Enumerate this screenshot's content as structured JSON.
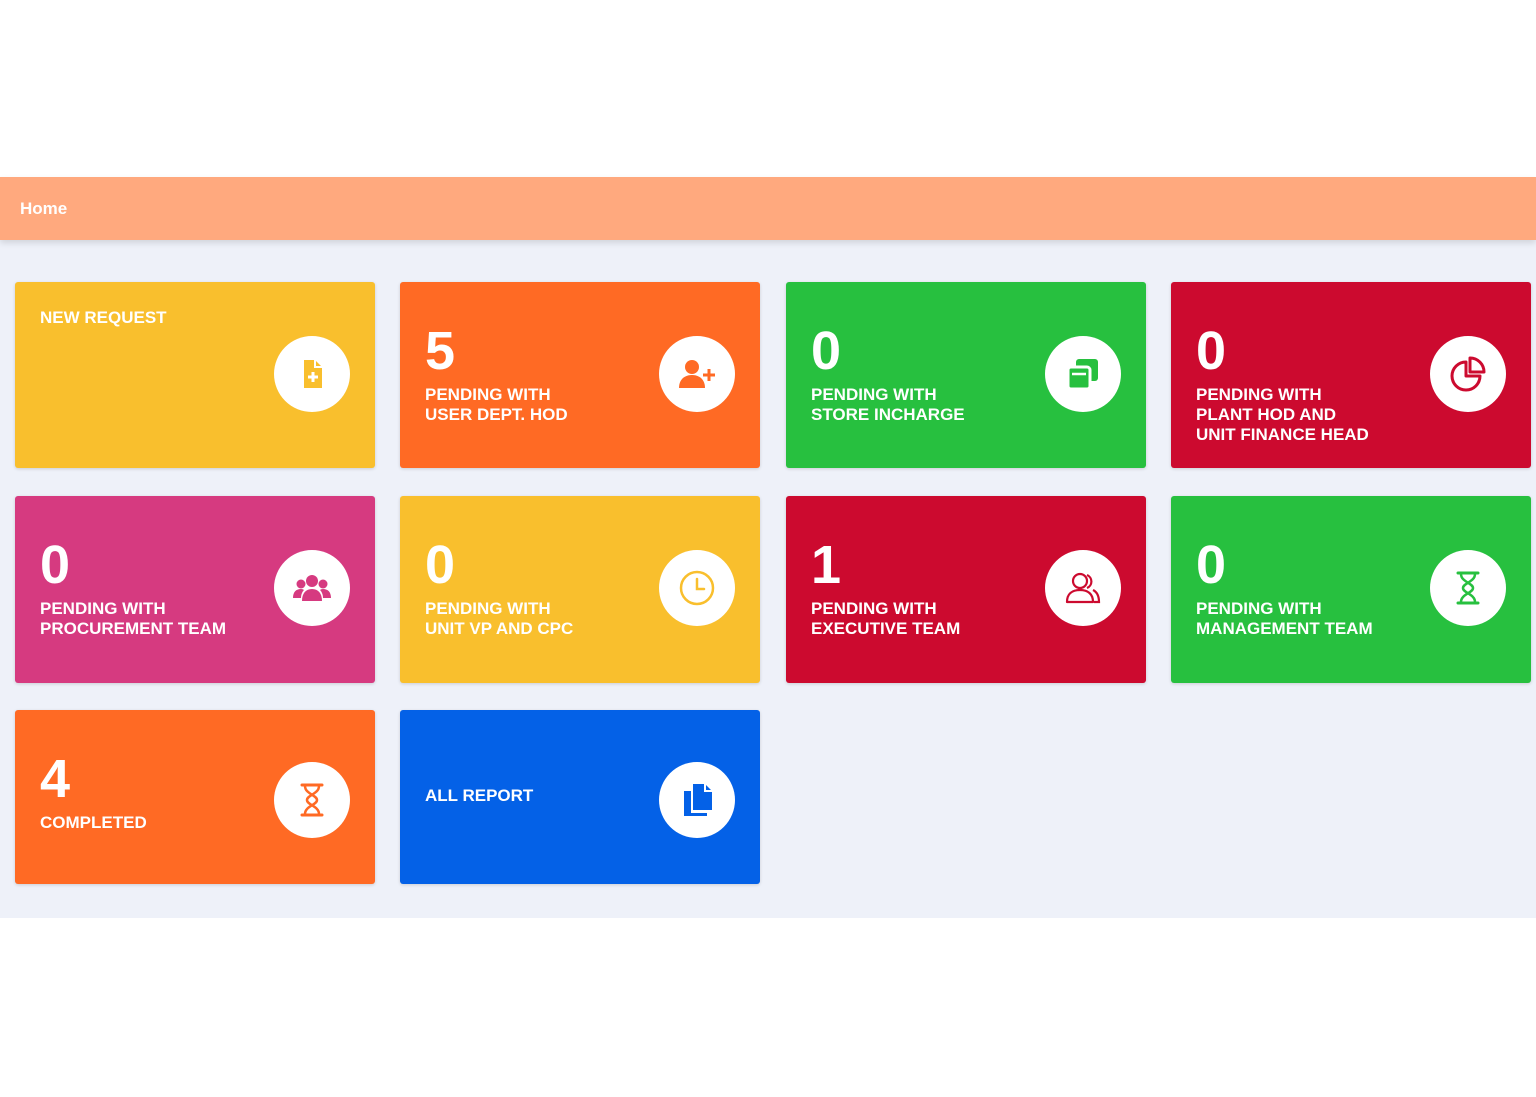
{
  "breadcrumb": {
    "home": "Home"
  },
  "tiles": [
    {
      "count": "",
      "label": [
        "NEW REQUEST"
      ],
      "color": "#f9bf2d",
      "icon": "file-plus-icon"
    },
    {
      "count": "5",
      "label": [
        "PENDING WITH",
        "USER DEPT. HOD"
      ],
      "color": "#ff6a24",
      "icon": "user-plus-icon"
    },
    {
      "count": "0",
      "label": [
        "PENDING WITH",
        "STORE INCHARGE"
      ],
      "color": "#27c03f",
      "icon": "copy-squares-icon"
    },
    {
      "count": "0",
      "label": [
        "PENDING WITH",
        "PLANT HOD AND",
        "UNIT FINANCE HEAD"
      ],
      "color": "#cc0a2f",
      "icon": "pie-chart-icon"
    },
    {
      "count": "0",
      "label": [
        "PENDING WITH",
        "PROCUREMENT TEAM"
      ],
      "color": "#d63a80",
      "icon": "users-group-icon"
    },
    {
      "count": "0",
      "label": [
        "PENDING WITH",
        "UNIT VP AND CPC"
      ],
      "color": "#f9bf2d",
      "icon": "clock-icon"
    },
    {
      "count": "1",
      "label": [
        "PENDING WITH",
        "EXECUTIVE TEAM"
      ],
      "color": "#cc0a2f",
      "icon": "users-outline-icon"
    },
    {
      "count": "0",
      "label": [
        "PENDING WITH",
        "MANAGEMENT TEAM"
      ],
      "color": "#27c03f",
      "icon": "hourglass-icon"
    },
    {
      "count": "4",
      "label": [
        "COMPLETED"
      ],
      "color": "#ff6a24",
      "icon": "hourglass-icon"
    },
    {
      "count": "",
      "label": [
        "ALL REPORT"
      ],
      "color": "#0461e7",
      "icon": "documents-icon"
    }
  ]
}
